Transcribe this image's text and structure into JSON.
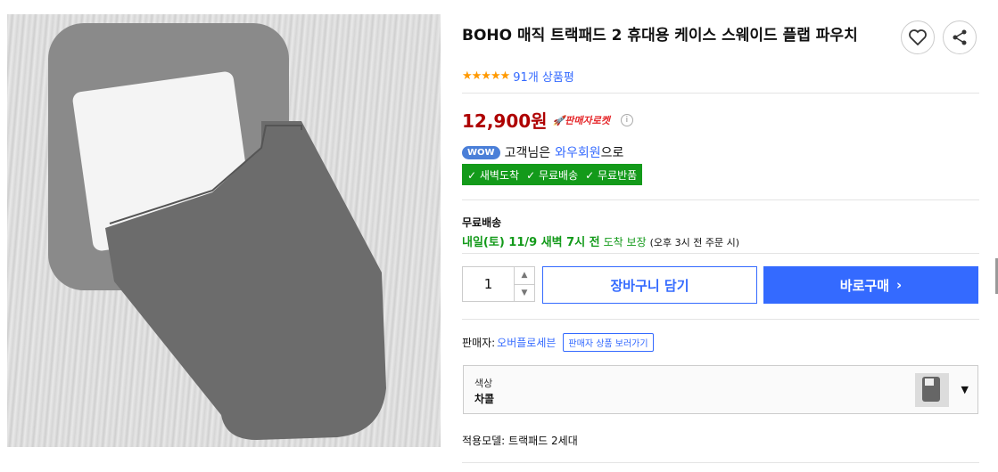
{
  "product": {
    "title": "BOHO 매직 트랙패드 2 휴대용 케이스 스웨이드 플랩 파우치",
    "stars": "★★★★★",
    "review_text": "91개 상품평",
    "price": "12,900원",
    "rocket_label": "판매자로켓"
  },
  "wow": {
    "badge": "WOW",
    "customer_text": "고객님은",
    "member_text": "와우회원",
    "suffix_text": "으로",
    "benefits": [
      "새벽도착",
      "무료배송",
      "무료반품"
    ]
  },
  "shipping": {
    "label": "무료배송",
    "date": "내일(토) 11/9 새벽 7시 전",
    "guarantee": "도착 보장",
    "note": "(오후 3시 전 주문 시)"
  },
  "purchase": {
    "quantity": "1",
    "cart_label": "장바구니 담기",
    "buy_label": "바로구매"
  },
  "seller": {
    "label": "판매자:",
    "name": "오버플로세븐",
    "link_label": "판매자 상품 보러가기"
  },
  "option": {
    "label": "색상",
    "value": "차콜"
  },
  "model": {
    "label": "적용모델:",
    "value": "트랙패드 2세대"
  },
  "colors": {
    "accent": "#346aff",
    "price": "#ae0000",
    "green": "#139a1a"
  },
  "icons": [
    "heart-icon",
    "share-icon",
    "info-icon",
    "check-icon",
    "chevron-right-icon",
    "caret-down-icon",
    "rocket-icon"
  ]
}
